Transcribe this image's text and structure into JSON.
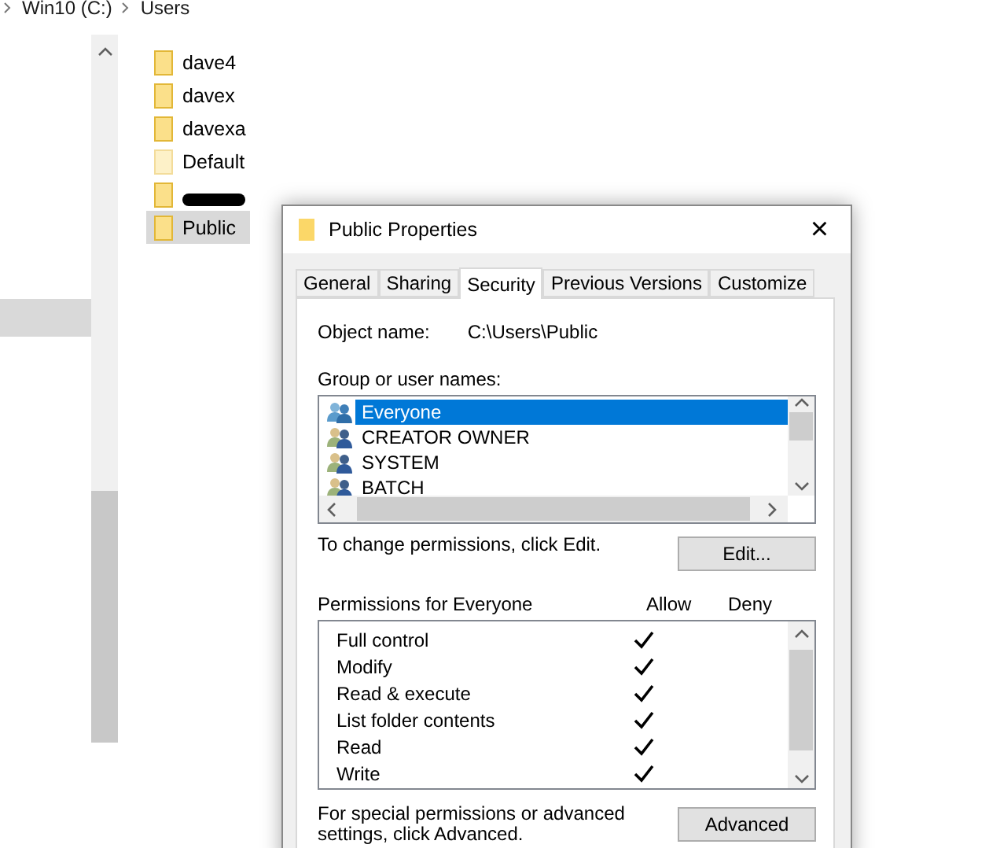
{
  "breadcrumb": [
    "Win10 (C:)",
    "Users"
  ],
  "folders": [
    {
      "name": "dave4",
      "selected": false,
      "kind": "normal"
    },
    {
      "name": "davex",
      "selected": false,
      "kind": "normal"
    },
    {
      "name": "davexa",
      "selected": false,
      "kind": "normal"
    },
    {
      "name": "Default",
      "selected": false,
      "kind": "hidden"
    },
    {
      "kind": "redacted",
      "selected": false
    },
    {
      "name": "Public",
      "selected": true,
      "kind": "normal"
    }
  ],
  "dialog": {
    "title": "Public Properties",
    "close": "×",
    "tabs": [
      {
        "label": "General",
        "selected": false
      },
      {
        "label": "Sharing",
        "selected": false
      },
      {
        "label": "Security",
        "selected": true
      },
      {
        "label": "Previous Versions",
        "selected": false
      },
      {
        "label": "Customize",
        "selected": false
      }
    ],
    "object_name_label": "Object name:",
    "object_name": "C:\\Users\\Public",
    "group_label": "Group or user names:",
    "groups": [
      {
        "name": "Everyone",
        "selected": true
      },
      {
        "name": "CREATOR OWNER",
        "selected": false
      },
      {
        "name": "SYSTEM",
        "selected": false
      },
      {
        "name": "BATCH",
        "selected": false
      }
    ],
    "change_hint": "To change permissions, click Edit.",
    "edit_button": "Edit...",
    "permissions_label": "Permissions for Everyone",
    "allow_label": "Allow",
    "deny_label": "Deny",
    "permissions": [
      {
        "name": "Full control",
        "allow": true,
        "deny": false
      },
      {
        "name": "Modify",
        "allow": true,
        "deny": false
      },
      {
        "name": "Read & execute",
        "allow": true,
        "deny": false
      },
      {
        "name": "List folder contents",
        "allow": true,
        "deny": false
      },
      {
        "name": "Read",
        "allow": true,
        "deny": false
      },
      {
        "name": "Write",
        "allow": true,
        "deny": false
      }
    ],
    "advanced_hint": "For special permissions or advanced settings, click Advanced.",
    "advanced_button": "Advanced"
  }
}
